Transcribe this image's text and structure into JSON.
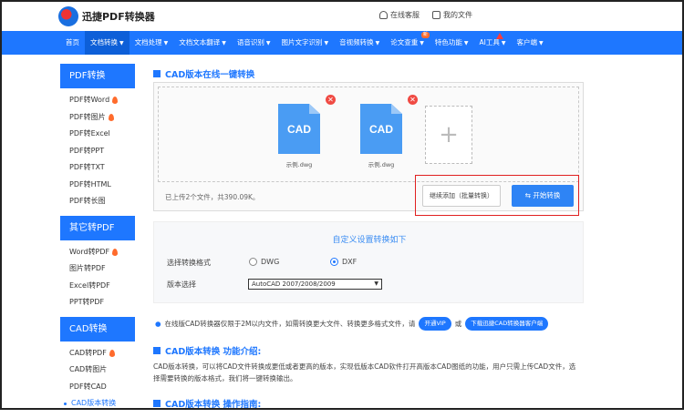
{
  "header": {
    "brand": "迅捷PDF转换器",
    "service": "在线客服",
    "my_files": "我的文件"
  },
  "nav": {
    "items": [
      {
        "label": "首页"
      },
      {
        "label": "文档转换"
      },
      {
        "label": "文档处理"
      },
      {
        "label": "文档文本翻译"
      },
      {
        "label": "语音识别"
      },
      {
        "label": "图片文字识别"
      },
      {
        "label": "音视频转换"
      },
      {
        "label": "论文查重",
        "badge": "新"
      },
      {
        "label": "特色功能"
      },
      {
        "label": "AI工具"
      },
      {
        "label": "客户端"
      }
    ]
  },
  "sidebar": {
    "groups": [
      {
        "title": "PDF转换",
        "items": [
          "PDF转Word",
          "PDF转图片",
          "PDF转Excel",
          "PDF转PPT",
          "PDF转TXT",
          "PDF转HTML",
          "PDF转长图"
        ]
      },
      {
        "title": "其它转PDF",
        "items": [
          "Word转PDF",
          "图片转PDF",
          "Excel转PDF",
          "PPT转PDF"
        ]
      },
      {
        "title": "CAD转换",
        "items": [
          "CAD转PDF",
          "CAD转图片",
          "PDF转CAD",
          "CAD版本转换"
        ]
      }
    ]
  },
  "main": {
    "title": "CAD版本在线一键转换",
    "files": [
      {
        "icon_text": "CAD",
        "name": "示例.dwg"
      },
      {
        "icon_text": "CAD",
        "name": "示例.dwg"
      }
    ],
    "add_icon": "+",
    "file_count": "已上传2个文件，共390.09K。",
    "continue_button": "继续添加（批量转换）",
    "start_button": "开始转换",
    "settings": {
      "title": "自定义设置转换如下",
      "format_label": "选择转换格式",
      "options": [
        "DWG",
        "DXF"
      ],
      "selected_option": "DXF",
      "version_label": "版本选择",
      "version_value": "AutoCAD 2007/2008/2009"
    },
    "notice": {
      "text": "在线版CAD转换器仅限于2M以内文件，如需转换更大文件、转换更多格式文件，请",
      "vip_button": "开通VIP",
      "or": "或",
      "download_button": "下载迅捷CAD转换器客户端"
    },
    "intro": {
      "title": "CAD版本转换 功能介绍:",
      "text": "CAD版本转换，可以将CAD文件转换成更低或者更高的版本，实现低版本CAD软件打开高版本CAD图纸的功能，用户只需上传CAD文件，选择需要转换的版本格式，我们将一键转换输出。"
    },
    "guide": {
      "title": "CAD版本转换 操作指南:"
    }
  },
  "colors": {
    "primary": "#1e77ff",
    "file_icon": "#4a9cf3",
    "highlight_border": "#e02020",
    "remove": "#f04a43"
  }
}
